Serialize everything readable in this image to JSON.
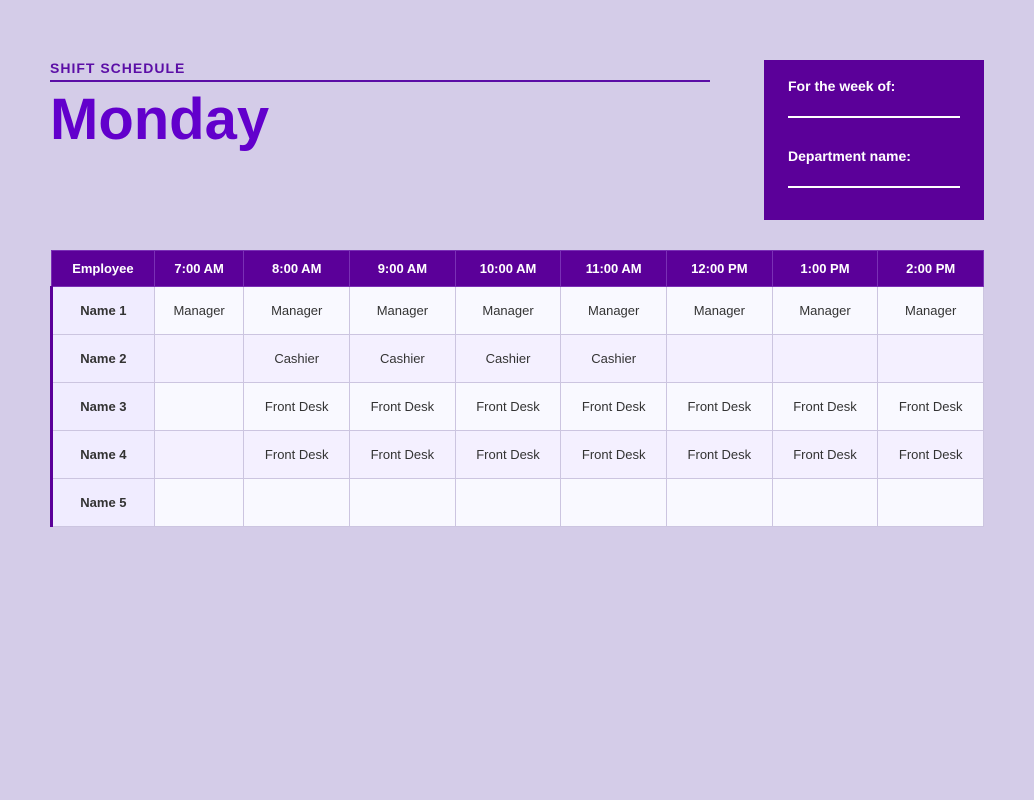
{
  "header": {
    "shift_label": "SHIFT SCHEDULE",
    "day": "Monday",
    "week_label": "For the week of:",
    "department_label": "Department name:"
  },
  "table": {
    "columns": [
      "Employee",
      "7:00 AM",
      "8:00 AM",
      "9:00 AM",
      "10:00 AM",
      "11:00 AM",
      "12:00 PM",
      "1:00 PM",
      "2:00 PM"
    ],
    "rows": [
      {
        "name": "Name 1",
        "cells": [
          "Manager",
          "Manager",
          "Manager",
          "Manager",
          "Manager",
          "Manager",
          "Manager",
          "Manager"
        ]
      },
      {
        "name": "Name 2",
        "cells": [
          "",
          "Cashier",
          "Cashier",
          "Cashier",
          "Cashier",
          "",
          "",
          ""
        ]
      },
      {
        "name": "Name 3",
        "cells": [
          "",
          "Front Desk",
          "Front Desk",
          "Front Desk",
          "Front Desk",
          "Front Desk",
          "Front Desk",
          "Front Desk"
        ]
      },
      {
        "name": "Name 4",
        "cells": [
          "",
          "Front Desk",
          "Front Desk",
          "Front Desk",
          "Front Desk",
          "Front Desk",
          "Front Desk",
          "Front Desk"
        ]
      },
      {
        "name": "Name 5",
        "cells": [
          "",
          "",
          "",
          "",
          "",
          "",
          "",
          ""
        ]
      }
    ]
  }
}
